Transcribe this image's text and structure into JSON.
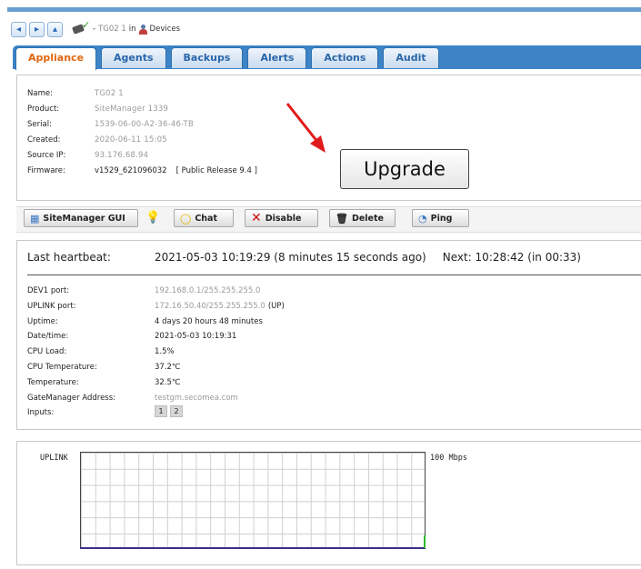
{
  "nav": {
    "back_icon": "left-arrow-icon",
    "forward_icon": "right-arrow-icon",
    "up_icon": "up-arrow-icon",
    "breadcrumb_prefix": "-",
    "breadcrumb_name": "TG02 1",
    "breadcrumb_in": "in",
    "breadcrumb_folder": "Devices"
  },
  "tabs": [
    {
      "label": "Appliance",
      "active": true
    },
    {
      "label": "Agents"
    },
    {
      "label": "Backups"
    },
    {
      "label": "Alerts"
    },
    {
      "label": "Actions"
    },
    {
      "label": "Audit"
    }
  ],
  "appliance": {
    "name_label": "Name:",
    "name_value": "TG02 1",
    "product_label": "Product:",
    "product_value": "SiteManager 1339",
    "serial_label": "Serial:",
    "serial_value": "1539-06-00-A2-36-46-TB",
    "created_label": "Created:",
    "created_value": "2020-06-11 15:05",
    "source_ip_label": "Source IP:",
    "source_ip_value": "93.176.68.94",
    "firmware_label": "Firmware:",
    "firmware_value": "v1529_621096032",
    "firmware_release": "[ Public Release 9.4 ]"
  },
  "upgrade_button": "Upgrade",
  "toolbar": {
    "sitemanager_gui": "SiteManager GUI",
    "chat": "Chat",
    "disable": "Disable",
    "delete": "Delete",
    "ping": "Ping"
  },
  "heartbeat": {
    "label": "Last heartbeat:",
    "value": "2021-05-03 10:19:29 (8 minutes 15 seconds ago)",
    "next": "Next: 10:28:42 (in 00:33)"
  },
  "stats": {
    "dev1_label": "DEV1 port:",
    "dev1_value": "192.168.0.1/255.255.255.0",
    "uplink_label": "UPLINK port:",
    "uplink_value": "172.16.50.40/255.255.255.0",
    "uplink_status": "(UP)",
    "uptime_label": "Uptime:",
    "uptime_value": "4 days 20 hours 48 minutes",
    "datetime_label": "Date/time:",
    "datetime_value": "2021-05-03 10:19:31",
    "cpu_load_label": "CPU Load:",
    "cpu_load_value": "1.5%",
    "cpu_temp_label": "CPU Temperature:",
    "cpu_temp_value": "37.2℃",
    "temp_label": "Temperature:",
    "temp_value": "32.5℃",
    "gm_label": "GateManager Address:",
    "gm_value": "testgm.secomea.com",
    "inputs_label": "Inputs:",
    "input1": "1",
    "input2": "2"
  },
  "graph": {
    "series_label": "UPLINK",
    "max_label": "100 Mbps"
  }
}
